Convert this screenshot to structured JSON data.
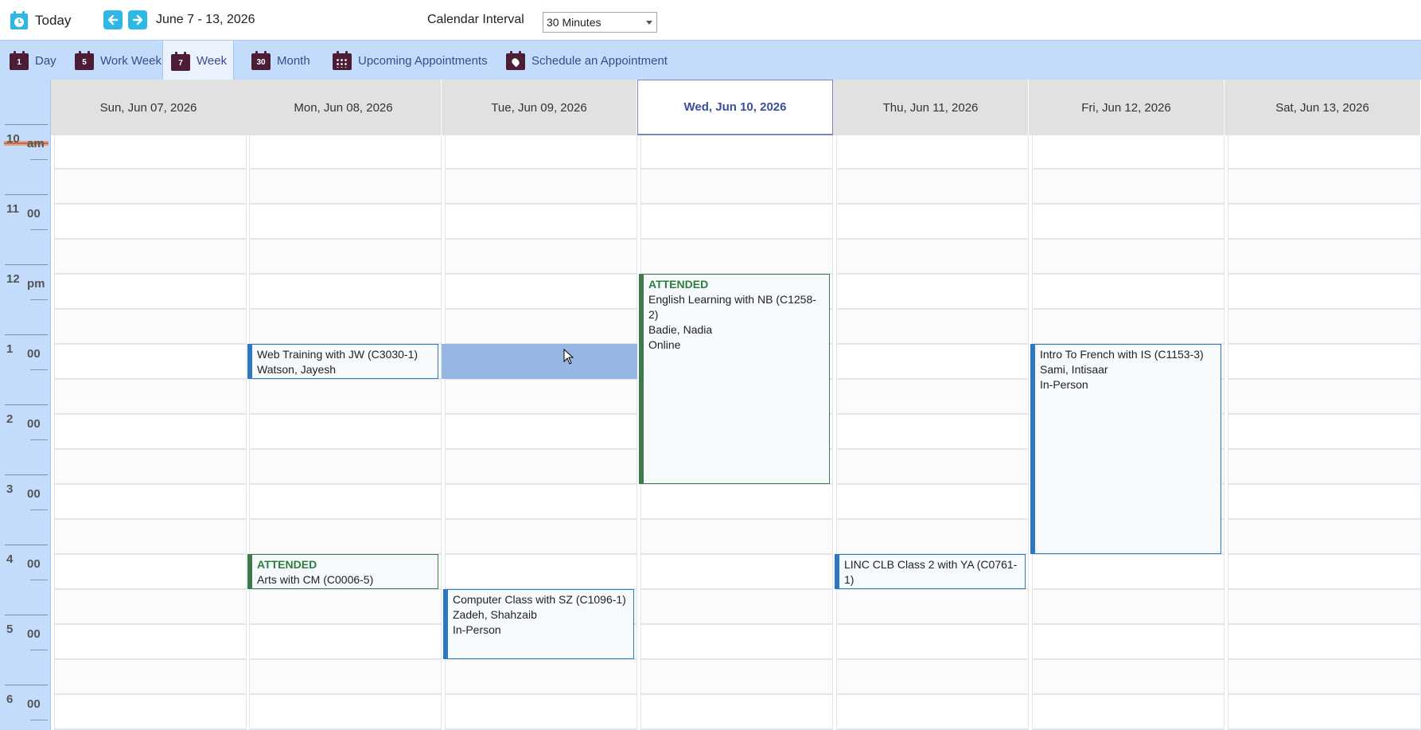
{
  "toolbar": {
    "today_label": "Today",
    "date_range": "June 7 - 13, 2026",
    "interval_label": "Calendar Interval",
    "interval_value": "30 Minutes",
    "accent_color": "#2db8e6"
  },
  "tabs": [
    {
      "label": "Day",
      "icon": "calendar-day-icon",
      "num": "1"
    },
    {
      "label": "Work Week",
      "icon": "calendar-work-week-icon",
      "num": "5"
    },
    {
      "label": "Week",
      "icon": "calendar-week-icon",
      "num": "7",
      "active": true
    },
    {
      "label": "Month",
      "icon": "calendar-month-icon",
      "num": "30"
    },
    {
      "label": "Upcoming Appointments",
      "icon": "calendar-grid-icon",
      "num": ""
    },
    {
      "label": "Schedule an Appointment",
      "icon": "calendar-pin-icon",
      "num": ""
    }
  ],
  "days": [
    {
      "label": "Sun, Jun 07, 2026"
    },
    {
      "label": "Mon, Jun 08, 2026"
    },
    {
      "label": "Tue, Jun 09, 2026"
    },
    {
      "label": "Wed, Jun 10, 2026",
      "today": true
    },
    {
      "label": "Thu, Jun 11, 2026"
    },
    {
      "label": "Fri, Jun 12, 2026"
    },
    {
      "label": "Sat, Jun 13, 2026"
    }
  ],
  "hours": [
    {
      "num": "10",
      "suffix": "am"
    },
    {
      "num": "11",
      "suffix": "00"
    },
    {
      "num": "12",
      "suffix": "pm"
    },
    {
      "num": "1",
      "suffix": "00"
    },
    {
      "num": "2",
      "suffix": "00"
    },
    {
      "num": "3",
      "suffix": "00"
    },
    {
      "num": "4",
      "suffix": "00"
    },
    {
      "num": "5",
      "suffix": "00"
    },
    {
      "num": "6",
      "suffix": "00"
    }
  ],
  "appointments": [
    {
      "day": 1,
      "start": "1:00 pm",
      "end": "1:30 pm",
      "status": "",
      "lines": [
        "Web Training with JW (C3030-1)",
        "Watson, Jayesh"
      ]
    },
    {
      "day": 1,
      "start": "4:00 pm",
      "end": "4:30 pm",
      "status": "ATTENDED",
      "lines": [
        "Arts with CM (C0006-5)"
      ]
    },
    {
      "day": 2,
      "start": "4:30 pm",
      "end": "5:30 pm",
      "status": "",
      "lines": [
        "Computer Class with SZ (C1096-1)",
        "Zadeh, Shahzaib",
        "In-Person"
      ]
    },
    {
      "day": 3,
      "start": "12:00 pm",
      "end": "3:00 pm",
      "status": "ATTENDED",
      "lines": [
        "English Learning  with NB (C1258-2)",
        "Badie, Nadia",
        "Online"
      ]
    },
    {
      "day": 4,
      "start": "4:00 pm",
      "end": "4:30 pm",
      "status": "",
      "lines": [
        "LINC CLB Class 2 with YA (C0761-1)"
      ]
    },
    {
      "day": 5,
      "start": "1:00 pm",
      "end": "4:00 pm",
      "status": "",
      "lines": [
        "Intro To French with IS (C1153-3)",
        "Sami, Intisaar",
        "In-Person"
      ]
    }
  ],
  "selection": {
    "day": 2,
    "start": "1:00 pm",
    "end": "1:30 pm"
  }
}
